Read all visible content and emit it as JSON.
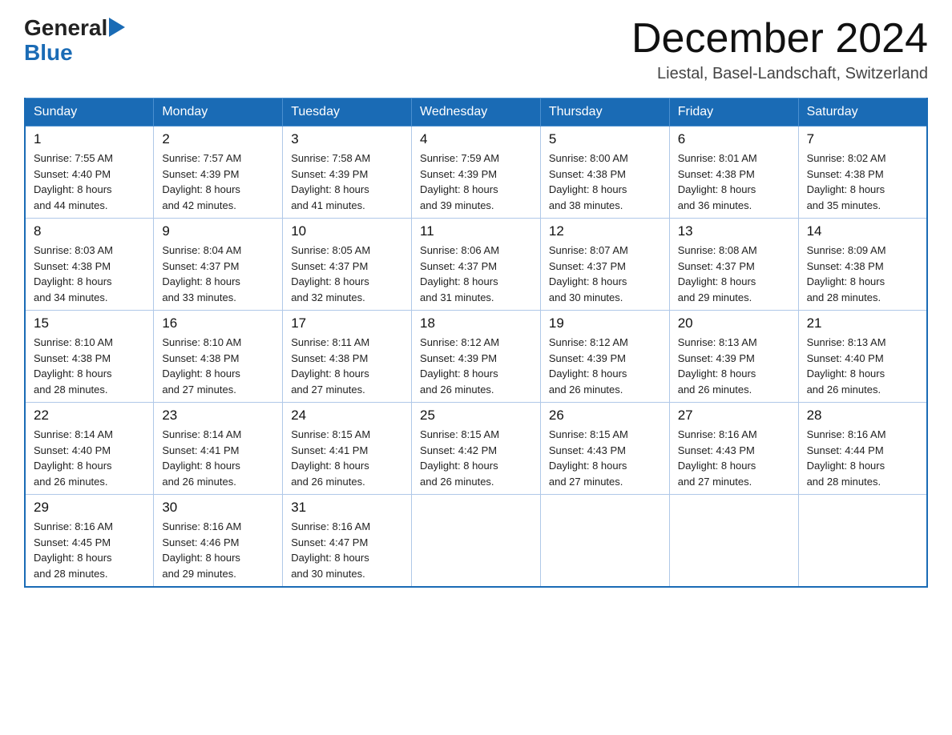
{
  "header": {
    "logo_general": "General",
    "logo_blue": "Blue",
    "month_title": "December 2024",
    "location": "Liestal, Basel-Landschaft, Switzerland"
  },
  "weekdays": [
    "Sunday",
    "Monday",
    "Tuesday",
    "Wednesday",
    "Thursday",
    "Friday",
    "Saturday"
  ],
  "weeks": [
    [
      {
        "day": "1",
        "sunrise": "7:55 AM",
        "sunset": "4:40 PM",
        "daylight": "8 hours and 44 minutes."
      },
      {
        "day": "2",
        "sunrise": "7:57 AM",
        "sunset": "4:39 PM",
        "daylight": "8 hours and 42 minutes."
      },
      {
        "day": "3",
        "sunrise": "7:58 AM",
        "sunset": "4:39 PM",
        "daylight": "8 hours and 41 minutes."
      },
      {
        "day": "4",
        "sunrise": "7:59 AM",
        "sunset": "4:39 PM",
        "daylight": "8 hours and 39 minutes."
      },
      {
        "day": "5",
        "sunrise": "8:00 AM",
        "sunset": "4:38 PM",
        "daylight": "8 hours and 38 minutes."
      },
      {
        "day": "6",
        "sunrise": "8:01 AM",
        "sunset": "4:38 PM",
        "daylight": "8 hours and 36 minutes."
      },
      {
        "day": "7",
        "sunrise": "8:02 AM",
        "sunset": "4:38 PM",
        "daylight": "8 hours and 35 minutes."
      }
    ],
    [
      {
        "day": "8",
        "sunrise": "8:03 AM",
        "sunset": "4:38 PM",
        "daylight": "8 hours and 34 minutes."
      },
      {
        "day": "9",
        "sunrise": "8:04 AM",
        "sunset": "4:37 PM",
        "daylight": "8 hours and 33 minutes."
      },
      {
        "day": "10",
        "sunrise": "8:05 AM",
        "sunset": "4:37 PM",
        "daylight": "8 hours and 32 minutes."
      },
      {
        "day": "11",
        "sunrise": "8:06 AM",
        "sunset": "4:37 PM",
        "daylight": "8 hours and 31 minutes."
      },
      {
        "day": "12",
        "sunrise": "8:07 AM",
        "sunset": "4:37 PM",
        "daylight": "8 hours and 30 minutes."
      },
      {
        "day": "13",
        "sunrise": "8:08 AM",
        "sunset": "4:37 PM",
        "daylight": "8 hours and 29 minutes."
      },
      {
        "day": "14",
        "sunrise": "8:09 AM",
        "sunset": "4:38 PM",
        "daylight": "8 hours and 28 minutes."
      }
    ],
    [
      {
        "day": "15",
        "sunrise": "8:10 AM",
        "sunset": "4:38 PM",
        "daylight": "8 hours and 28 minutes."
      },
      {
        "day": "16",
        "sunrise": "8:10 AM",
        "sunset": "4:38 PM",
        "daylight": "8 hours and 27 minutes."
      },
      {
        "day": "17",
        "sunrise": "8:11 AM",
        "sunset": "4:38 PM",
        "daylight": "8 hours and 27 minutes."
      },
      {
        "day": "18",
        "sunrise": "8:12 AM",
        "sunset": "4:39 PM",
        "daylight": "8 hours and 26 minutes."
      },
      {
        "day": "19",
        "sunrise": "8:12 AM",
        "sunset": "4:39 PM",
        "daylight": "8 hours and 26 minutes."
      },
      {
        "day": "20",
        "sunrise": "8:13 AM",
        "sunset": "4:39 PM",
        "daylight": "8 hours and 26 minutes."
      },
      {
        "day": "21",
        "sunrise": "8:13 AM",
        "sunset": "4:40 PM",
        "daylight": "8 hours and 26 minutes."
      }
    ],
    [
      {
        "day": "22",
        "sunrise": "8:14 AM",
        "sunset": "4:40 PM",
        "daylight": "8 hours and 26 minutes."
      },
      {
        "day": "23",
        "sunrise": "8:14 AM",
        "sunset": "4:41 PM",
        "daylight": "8 hours and 26 minutes."
      },
      {
        "day": "24",
        "sunrise": "8:15 AM",
        "sunset": "4:41 PM",
        "daylight": "8 hours and 26 minutes."
      },
      {
        "day": "25",
        "sunrise": "8:15 AM",
        "sunset": "4:42 PM",
        "daylight": "8 hours and 26 minutes."
      },
      {
        "day": "26",
        "sunrise": "8:15 AM",
        "sunset": "4:43 PM",
        "daylight": "8 hours and 27 minutes."
      },
      {
        "day": "27",
        "sunrise": "8:16 AM",
        "sunset": "4:43 PM",
        "daylight": "8 hours and 27 minutes."
      },
      {
        "day": "28",
        "sunrise": "8:16 AM",
        "sunset": "4:44 PM",
        "daylight": "8 hours and 28 minutes."
      }
    ],
    [
      {
        "day": "29",
        "sunrise": "8:16 AM",
        "sunset": "4:45 PM",
        "daylight": "8 hours and 28 minutes."
      },
      {
        "day": "30",
        "sunrise": "8:16 AM",
        "sunset": "4:46 PM",
        "daylight": "8 hours and 29 minutes."
      },
      {
        "day": "31",
        "sunrise": "8:16 AM",
        "sunset": "4:47 PM",
        "daylight": "8 hours and 30 minutes."
      },
      null,
      null,
      null,
      null
    ]
  ],
  "labels": {
    "sunrise": "Sunrise:",
    "sunset": "Sunset:",
    "daylight": "Daylight:"
  }
}
